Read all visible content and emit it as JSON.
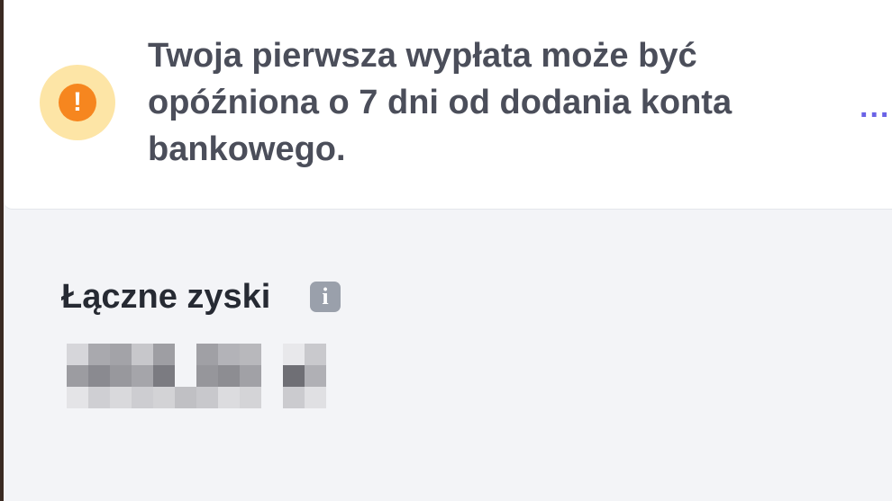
{
  "notice": {
    "icon": "exclamation-icon",
    "icon_glyph": "!",
    "message": "Twoja pierwsza wypłata może być opóźniona o 7 dni od dodania konta bankowego.",
    "more_label": "...",
    "colors": {
      "badge_outer": "#fde5a6",
      "badge_inner": "#f6861f",
      "more": "#6a63e6"
    }
  },
  "earnings": {
    "label": "Łączne zyski",
    "info_icon": "info-icon",
    "info_glyph": "i",
    "value_redacted": true
  }
}
